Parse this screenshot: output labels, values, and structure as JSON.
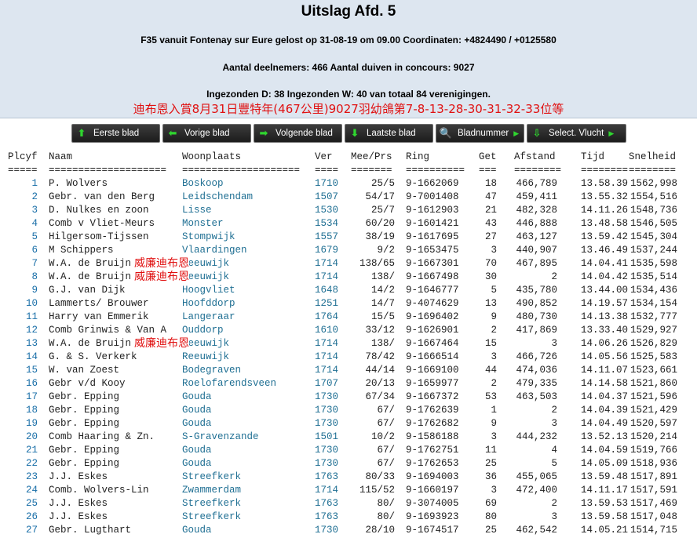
{
  "header": {
    "title": "Uitslag Afd. 5",
    "line1": "F35 vanuit Fontenay sur Eure gelost op 31-08-19 om 09.00 Coordinaten: +4824490 / +0125580",
    "line2": "Aantal deelnemers: 466 Aantal duiven in concours: 9027",
    "line3": "Ingezonden D: 38 Ingezonden W: 40 van totaal 84 verenigingen.",
    "note": "迪布恩入賞8月31日豐特年(467公里)9027羽幼鴿第7-8-13-28-30-31-32-33位等"
  },
  "toolbar": {
    "first": "Eerste blad",
    "prev": "Vorige blad",
    "next": "Volgende blad",
    "last": "Laatste blad",
    "page": "Bladnummer",
    "select": "Select. Vlucht"
  },
  "columns": {
    "pl": "Plcyf",
    "naam": "Naam",
    "woon": "Woonplaats",
    "ver": "Ver",
    "mee": "Mee/Prs",
    "ring": "Ring",
    "get": "Get",
    "afs": "Afstand",
    "tijd": "Tijd",
    "snel": "Snelheid"
  },
  "separators": {
    "pl": "=====",
    "naam": "====================",
    "woon": "====================",
    "ver": "====",
    "mee": "=======",
    "ring": "==========",
    "get": "===",
    "afs": "========",
    "tijd": "========",
    "snel": "========"
  },
  "overlay_text": "威廉迪布恩",
  "rows": [
    {
      "pl": "1",
      "naam": "P. Wolvers",
      "woon": "Boskoop",
      "ver": "1710",
      "mee": "25/5",
      "ring": "9-1662069",
      "get": "18",
      "afs": "466,789",
      "tijd": "13.58.39",
      "snel": "1562,998"
    },
    {
      "pl": "2",
      "naam": "Gebr. van den Berg",
      "woon": "Leidschendam",
      "ver": "1507",
      "mee": "54/17",
      "ring": "9-7001408",
      "get": "47",
      "afs": "459,411",
      "tijd": "13.55.32",
      "snel": "1554,516"
    },
    {
      "pl": "3",
      "naam": "D. Nulkes en zoon",
      "woon": "Lisse",
      "ver": "1530",
      "mee": "25/7",
      "ring": "9-1612903",
      "get": "21",
      "afs": "482,328",
      "tijd": "14.11.26",
      "snel": "1548,736"
    },
    {
      "pl": "4",
      "naam": "Comb v Vliet-Meurs",
      "woon": "Monster",
      "ver": "1534",
      "mee": "60/20",
      "ring": "9-1601421",
      "get": "43",
      "afs": "446,888",
      "tijd": "13.48.58",
      "snel": "1546,505"
    },
    {
      "pl": "5",
      "naam": "Hilgersom-Tijssen",
      "woon": "Stompwijk",
      "ver": "1557",
      "mee": "38/19",
      "ring": "9-1617695",
      "get": "27",
      "afs": "463,127",
      "tijd": "13.59.42",
      "snel": "1545,304"
    },
    {
      "pl": "6",
      "naam": "M Schippers",
      "woon": "Vlaardingen",
      "ver": "1679",
      "mee": "9/2",
      "ring": "9-1653475",
      "get": "3",
      "afs": "440,907",
      "tijd": "13.46.49",
      "snel": "1537,244"
    },
    {
      "pl": "7",
      "naam": "W.A. de Bruijn",
      "woon": "Reeuwijk",
      "ver": "1714",
      "mee": "138/65",
      "ring": "9-1667301",
      "get": "70",
      "afs": "467,895",
      "tijd": "14.04.41",
      "snel": "1535,598",
      "ov": true
    },
    {
      "pl": "8",
      "naam": "W.A. de Bruijn",
      "woon": "Reeuwijk",
      "ver": "1714",
      "mee": "138/",
      "ring": "9-1667498",
      "get": "30",
      "afs": "2",
      "tijd": "14.04.42",
      "snel": "1535,514",
      "ov": true
    },
    {
      "pl": "9",
      "naam": "G.J. van Dijk",
      "woon": "Hoogvliet",
      "ver": "1648",
      "mee": "14/2",
      "ring": "9-1646777",
      "get": "5",
      "afs": "435,780",
      "tijd": "13.44.00",
      "snel": "1534,436"
    },
    {
      "pl": "10",
      "naam": "Lammerts/ Brouwer",
      "woon": "Hoofddorp",
      "ver": "1251",
      "mee": "14/7",
      "ring": "9-4074629",
      "get": "13",
      "afs": "490,852",
      "tijd": "14.19.57",
      "snel": "1534,154"
    },
    {
      "pl": "11",
      "naam": "Harry van Emmerik",
      "woon": "Langeraar",
      "ver": "1764",
      "mee": "15/5",
      "ring": "9-1696402",
      "get": "9",
      "afs": "480,730",
      "tijd": "14.13.38",
      "snel": "1532,777"
    },
    {
      "pl": "12",
      "naam": "Comb Grinwis & Van A",
      "woon": "Ouddorp",
      "ver": "1610",
      "mee": "33/12",
      "ring": "9-1626901",
      "get": "2",
      "afs": "417,869",
      "tijd": "13.33.40",
      "snel": "1529,927"
    },
    {
      "pl": "13",
      "naam": "W.A. de Bruijn",
      "woon": "Reeuwijk",
      "ver": "1714",
      "mee": "138/",
      "ring": "9-1667464",
      "get": "15",
      "afs": "3",
      "tijd": "14.06.26",
      "snel": "1526,829",
      "ov": true
    },
    {
      "pl": "14",
      "naam": "G. & S. Verkerk",
      "woon": "Reeuwijk",
      "ver": "1714",
      "mee": "78/42",
      "ring": "9-1666514",
      "get": "3",
      "afs": "466,726",
      "tijd": "14.05.56",
      "snel": "1525,583"
    },
    {
      "pl": "15",
      "naam": "W. van Zoest",
      "woon": "Bodegraven",
      "ver": "1714",
      "mee": "44/14",
      "ring": "9-1669100",
      "get": "44",
      "afs": "474,036",
      "tijd": "14.11.07",
      "snel": "1523,661"
    },
    {
      "pl": "16",
      "naam": "Gebr v/d Kooy",
      "woon": "Roelofarendsveen",
      "ver": "1707",
      "mee": "20/13",
      "ring": "9-1659977",
      "get": "2",
      "afs": "479,335",
      "tijd": "14.14.58",
      "snel": "1521,860"
    },
    {
      "pl": "17",
      "naam": "Gebr. Epping",
      "woon": "Gouda",
      "ver": "1730",
      "mee": "67/34",
      "ring": "9-1667372",
      "get": "53",
      "afs": "463,503",
      "tijd": "14.04.37",
      "snel": "1521,596"
    },
    {
      "pl": "18",
      "naam": "Gebr. Epping",
      "woon": "Gouda",
      "ver": "1730",
      "mee": "67/",
      "ring": "9-1762639",
      "get": "1",
      "afs": "2",
      "tijd": "14.04.39",
      "snel": "1521,429"
    },
    {
      "pl": "19",
      "naam": "Gebr. Epping",
      "woon": "Gouda",
      "ver": "1730",
      "mee": "67/",
      "ring": "9-1762682",
      "get": "9",
      "afs": "3",
      "tijd": "14.04.49",
      "snel": "1520,597"
    },
    {
      "pl": "20",
      "naam": "Comb Haaring & Zn.",
      "woon": "S-Gravenzande",
      "ver": "1501",
      "mee": "10/2",
      "ring": "9-1586188",
      "get": "3",
      "afs": "444,232",
      "tijd": "13.52.13",
      "snel": "1520,214"
    },
    {
      "pl": "21",
      "naam": "Gebr. Epping",
      "woon": "Gouda",
      "ver": "1730",
      "mee": "67/",
      "ring": "9-1762751",
      "get": "11",
      "afs": "4",
      "tijd": "14.04.59",
      "snel": "1519,766"
    },
    {
      "pl": "22",
      "naam": "Gebr. Epping",
      "woon": "Gouda",
      "ver": "1730",
      "mee": "67/",
      "ring": "9-1762653",
      "get": "25",
      "afs": "5",
      "tijd": "14.05.09",
      "snel": "1518,936"
    },
    {
      "pl": "23",
      "naam": "J.J. Eskes",
      "woon": "Streefkerk",
      "ver": "1763",
      "mee": "80/33",
      "ring": "9-1694003",
      "get": "36",
      "afs": "455,065",
      "tijd": "13.59.48",
      "snel": "1517,891"
    },
    {
      "pl": "24",
      "naam": "Comb. Wolvers-Lin",
      "woon": "Zwammerdam",
      "ver": "1714",
      "mee": "115/52",
      "ring": "9-1660197",
      "get": "3",
      "afs": "472,400",
      "tijd": "14.11.17",
      "snel": "1517,591"
    },
    {
      "pl": "25",
      "naam": "J.J. Eskes",
      "woon": "Streefkerk",
      "ver": "1763",
      "mee": "80/",
      "ring": "9-3074005",
      "get": "69",
      "afs": "2",
      "tijd": "13.59.53",
      "snel": "1517,469"
    },
    {
      "pl": "26",
      "naam": "J.J. Eskes",
      "woon": "Streefkerk",
      "ver": "1763",
      "mee": "80/",
      "ring": "9-1693923",
      "get": "80",
      "afs": "3",
      "tijd": "13.59.58",
      "snel": "1517,048"
    },
    {
      "pl": "27",
      "naam": "Gebr. Lugthart",
      "woon": "Gouda",
      "ver": "1730",
      "mee": "28/10",
      "ring": "9-1674517",
      "get": "25",
      "afs": "462,542",
      "tijd": "14.05.21",
      "snel": "1514,715"
    }
  ]
}
